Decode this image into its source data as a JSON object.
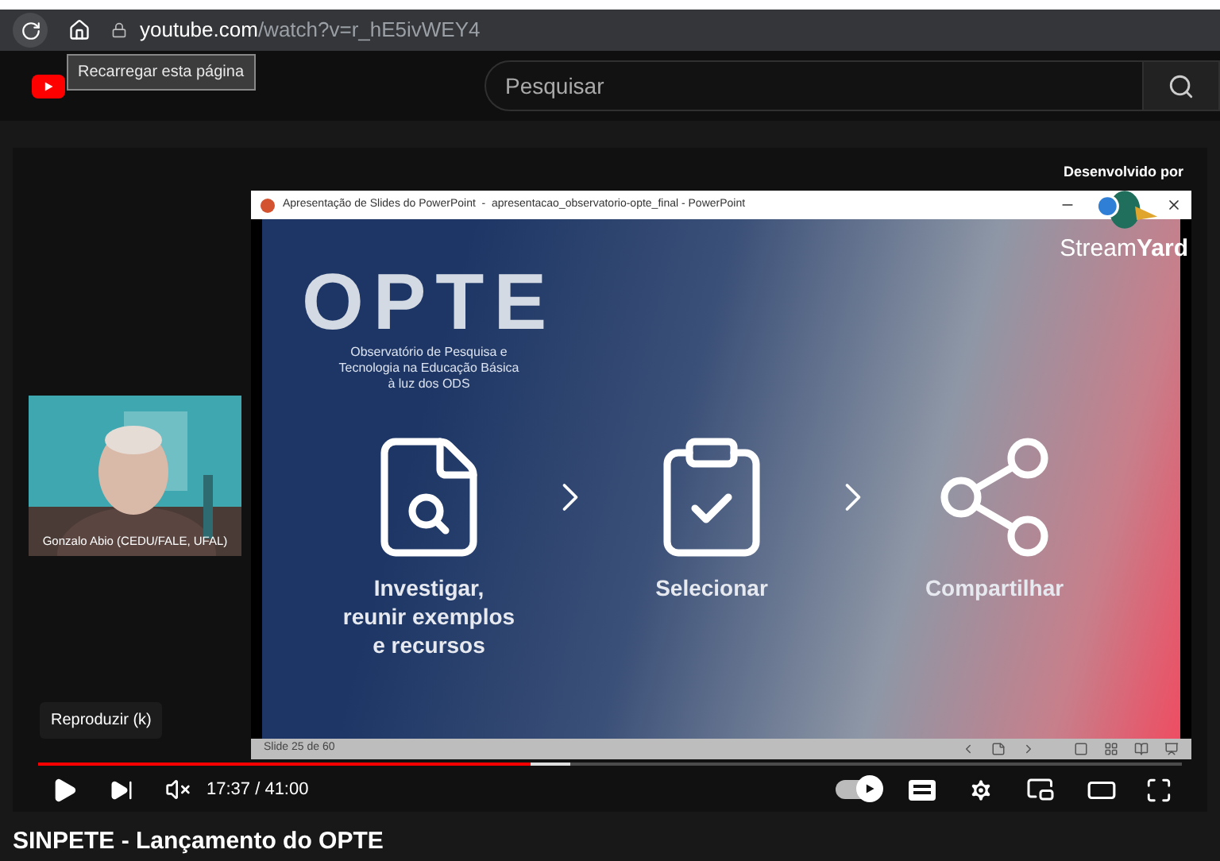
{
  "browser": {
    "url_host": "youtube.com",
    "url_path": "/watch?v=r_hE5ivWEY4",
    "tooltip": "Recarregar esta página"
  },
  "header": {
    "search": {
      "placeholder": "Pesquisar"
    }
  },
  "video": {
    "credit": "Desenvolvido por",
    "brand": {
      "light": "Stream",
      "bold": "Yard"
    },
    "webcam": {
      "kind": "picture",
      "name": "Gonzalo Abio (CEDU/FALE, UFAL)"
    },
    "slide_window": {
      "title": "Apresentação de Slides do PowerPoint  -  apresentacao_observatorio-opte_final - PowerPoint",
      "logo": "OPTE",
      "subtitle": [
        "Observatório de Pesquisa e",
        "Tecnologia na Educação Básica",
        "à luz dos ODS"
      ],
      "steps": [
        {
          "kind": "research",
          "lines": [
            "Investigar,",
            "reunir exemplos",
            "e recursos"
          ]
        },
        {
          "kind": "checklist",
          "lines": [
            "Selecionar"
          ]
        },
        {
          "kind": "network",
          "lines": [
            "Compartilhar"
          ]
        }
      ],
      "status": "Slide 25 de 60"
    },
    "tooltip": "Reproduzir (k)",
    "progress": {
      "level": 0.43
    },
    "buffer": {
      "level": 0.465
    },
    "time": "17:37 / 41:00",
    "muted": true,
    "autoplay": true
  },
  "title": "SINPETE - Lançamento do OPTE"
}
